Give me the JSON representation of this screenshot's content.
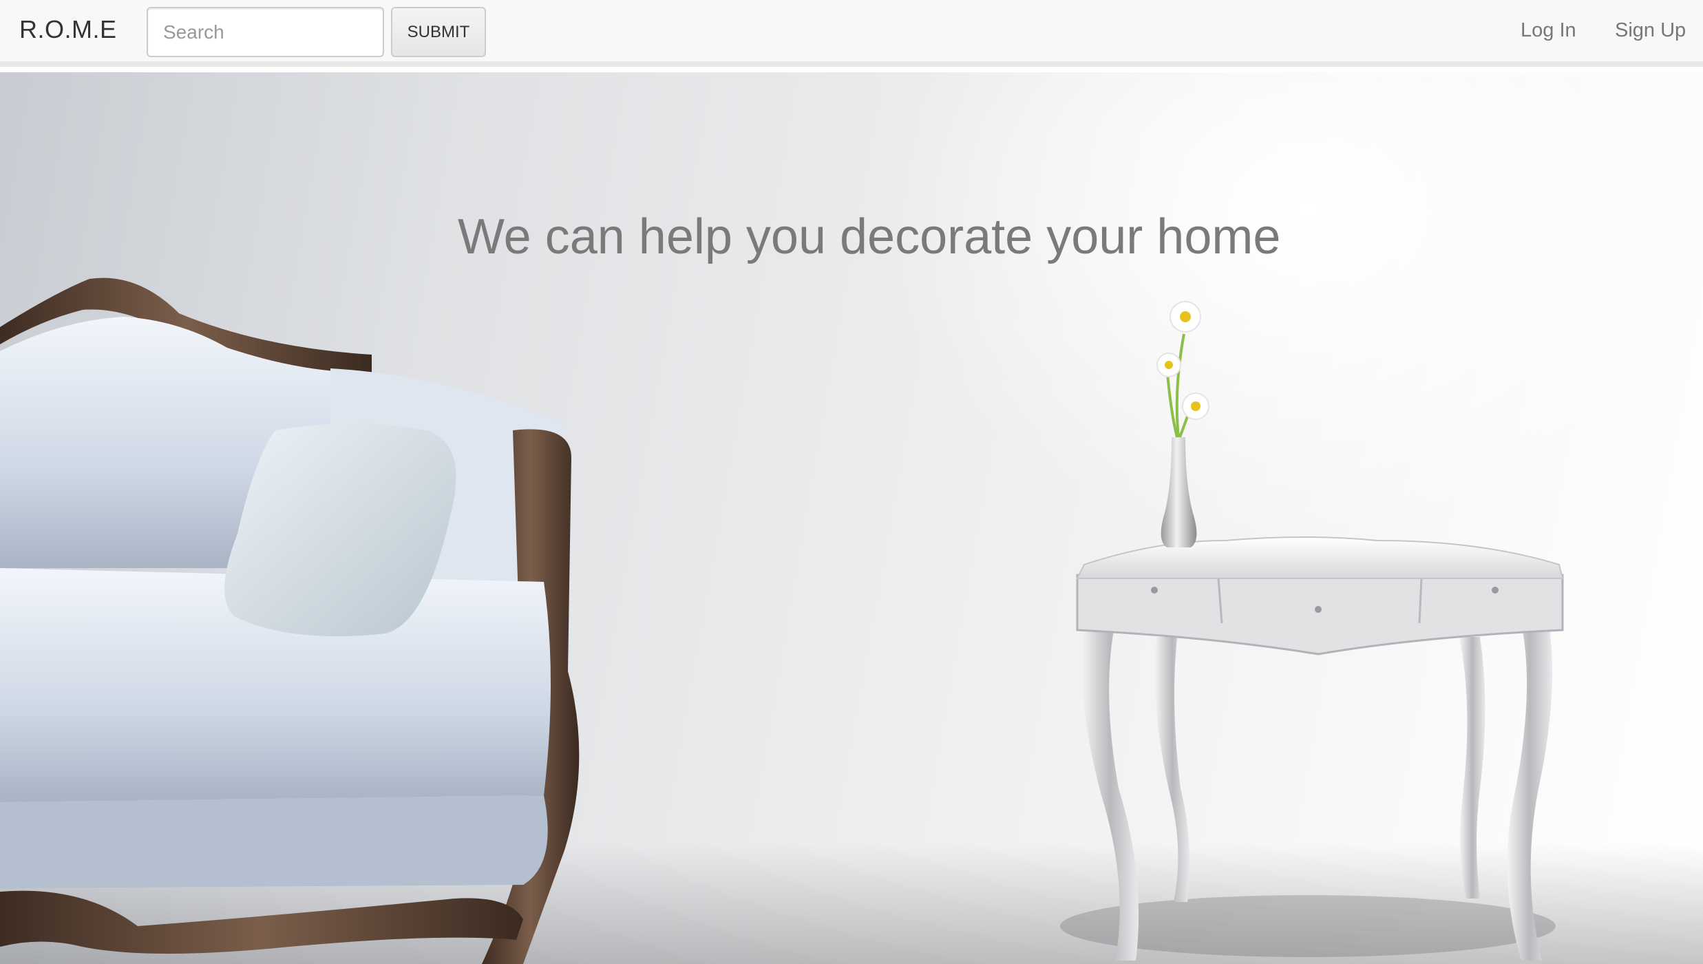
{
  "navbar": {
    "brand": "R.O.M.E",
    "search": {
      "placeholder": "Search",
      "value": ""
    },
    "submit_label": "SUBMIT",
    "links": {
      "login": "Log In",
      "signup": "Sign Up"
    }
  },
  "hero": {
    "headline": "We can help you decorate your home"
  },
  "colors": {
    "navbar_bg": "#f8f8f8",
    "headline": "#7a7a7a",
    "link": "#777777"
  }
}
